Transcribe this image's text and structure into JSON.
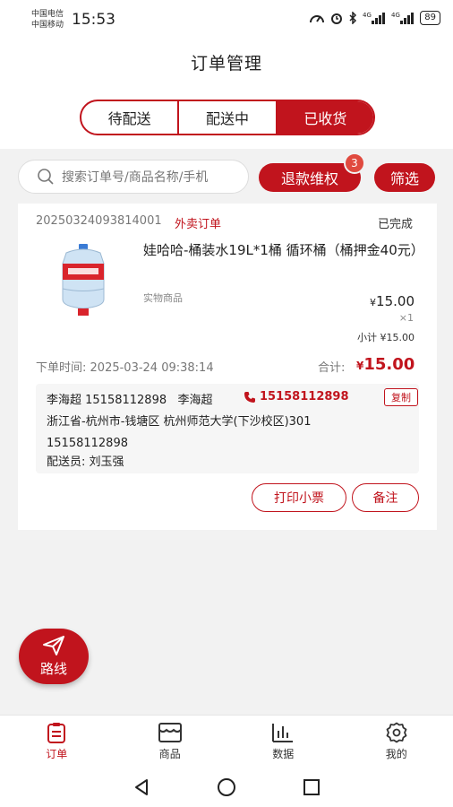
{
  "status_bar": {
    "carrier_1": "中国电信",
    "carrier_2": "中国移动",
    "time": "15:53",
    "battery": "89"
  },
  "header": {
    "title": "订单管理"
  },
  "tabs": [
    {
      "label": "待配送",
      "active": false
    },
    {
      "label": "配送中",
      "active": false
    },
    {
      "label": "已收货",
      "active": true
    }
  ],
  "search": {
    "placeholder": "搜索订单号/商品名称/手机"
  },
  "actions": {
    "refund_label": "退款维权",
    "refund_badge": "3",
    "filter_label": "筛选"
  },
  "order": {
    "order_no": "20250324093814001",
    "order_type": "外卖订单",
    "status": "已完成",
    "product": {
      "name": "娃哈哈-桶装水19L*1桶 循环桶（桶押金40元）",
      "tag": "实物商品",
      "currency": "¥",
      "price": "15.00",
      "qty": "×1",
      "subtotal": "小计 ¥15.00"
    },
    "time_label": "下单时间:",
    "time_value": "2025-03-24 09:38:14",
    "total_label": "合计:",
    "total_currency": "¥",
    "total_value": "15.00",
    "contact": "李海超 15158112898   李海超",
    "contact_phone": "15158112898",
    "copy_label": "复制",
    "address_line": "浙江省-杭州市-钱塘区 杭州师范大学(下沙校区)301",
    "address_phone": "15158112898",
    "courier": "配送员: 刘玉强",
    "print_label": "打印小票",
    "remark_label": "备注"
  },
  "route_label": "路线",
  "bottom_nav": [
    {
      "label": "订单",
      "icon": "order-icon",
      "active": true
    },
    {
      "label": "商品",
      "icon": "shop-icon",
      "active": false
    },
    {
      "label": "数据",
      "icon": "chart-icon",
      "active": false
    },
    {
      "label": "我的",
      "icon": "gear-icon",
      "active": false
    }
  ],
  "colors": {
    "accent": "#c1141d",
    "badge": "#e04a3f",
    "background": "#f2f2f2"
  }
}
